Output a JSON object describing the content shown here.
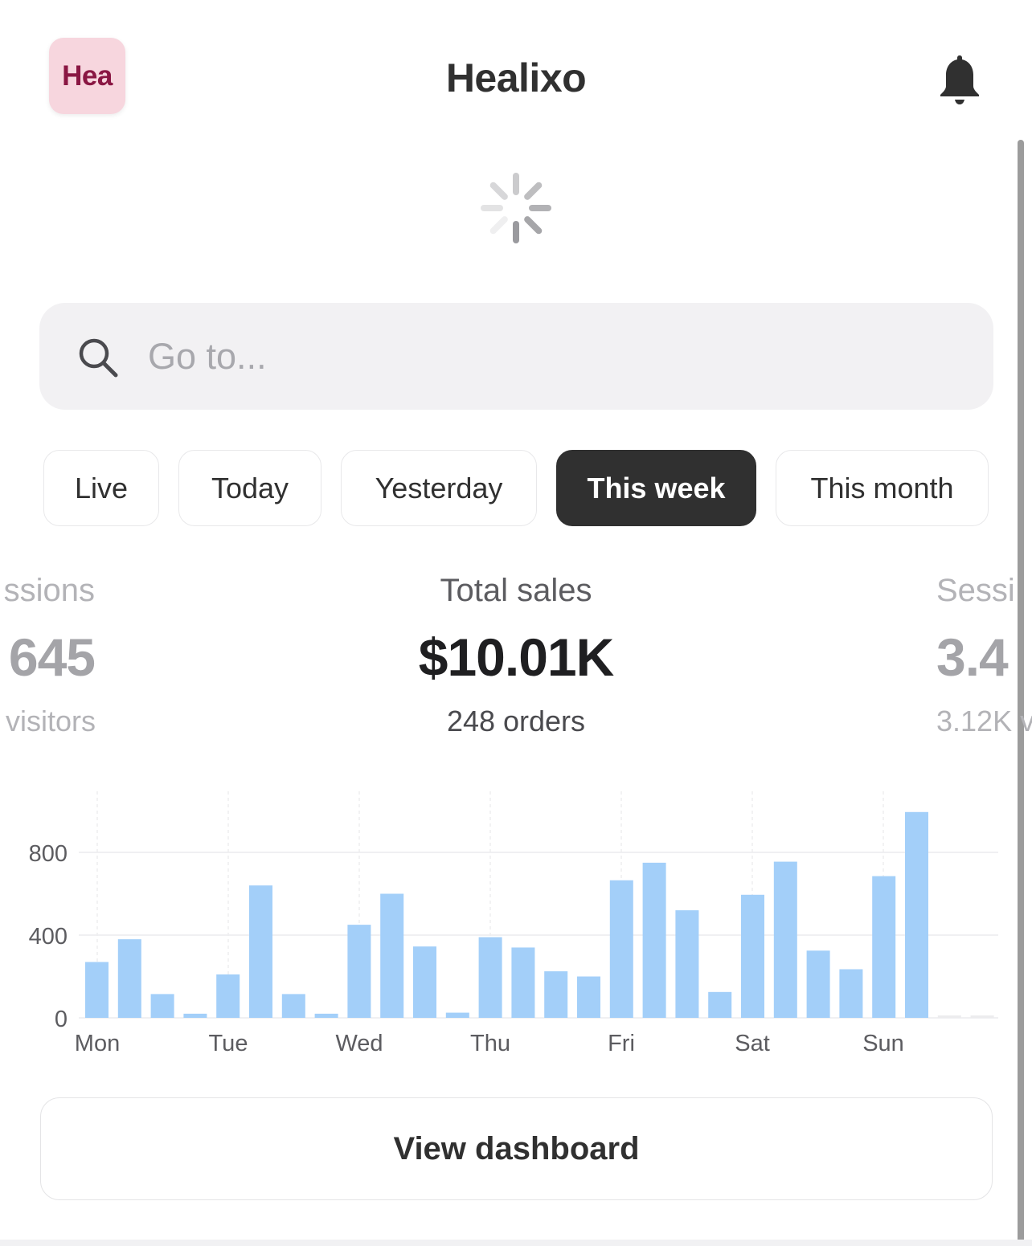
{
  "header": {
    "store_initials": "Hea",
    "title": "Healixo",
    "bell_icon": "bell-icon"
  },
  "search": {
    "placeholder": "Go to...",
    "icon": "search-icon"
  },
  "filters": [
    {
      "label": "Live",
      "active": false
    },
    {
      "label": "Today",
      "active": false
    },
    {
      "label": "Yesterday",
      "active": false
    },
    {
      "label": "This week",
      "active": true
    },
    {
      "label": "This month",
      "active": false
    }
  ],
  "metrics": {
    "left": {
      "label": "ssions",
      "value": "645",
      "sub": "visitors"
    },
    "center": {
      "label": "Total sales",
      "value": "$10.01K",
      "sub": "248 orders"
    },
    "right": {
      "label": "Sessi",
      "value": "3.4",
      "sub": "3.12K v"
    }
  },
  "chart_data": {
    "type": "bar",
    "y_ticks": [
      "0",
      "400",
      "800"
    ],
    "ylim": [
      0,
      1000
    ],
    "categories": [
      "Mon",
      "Tue",
      "Wed",
      "Thu",
      "Fri",
      "Sat",
      "Sun"
    ],
    "values": [
      270,
      380,
      115,
      20,
      210,
      640,
      115,
      20,
      450,
      600,
      345,
      25,
      390,
      340,
      225,
      200,
      665,
      750,
      520,
      125,
      595,
      755,
      325,
      235,
      685,
      995,
      0,
      0
    ],
    "bar_color": "#a3cff9",
    "grid": true
  },
  "actions": {
    "view_dashboard": "View dashboard"
  }
}
